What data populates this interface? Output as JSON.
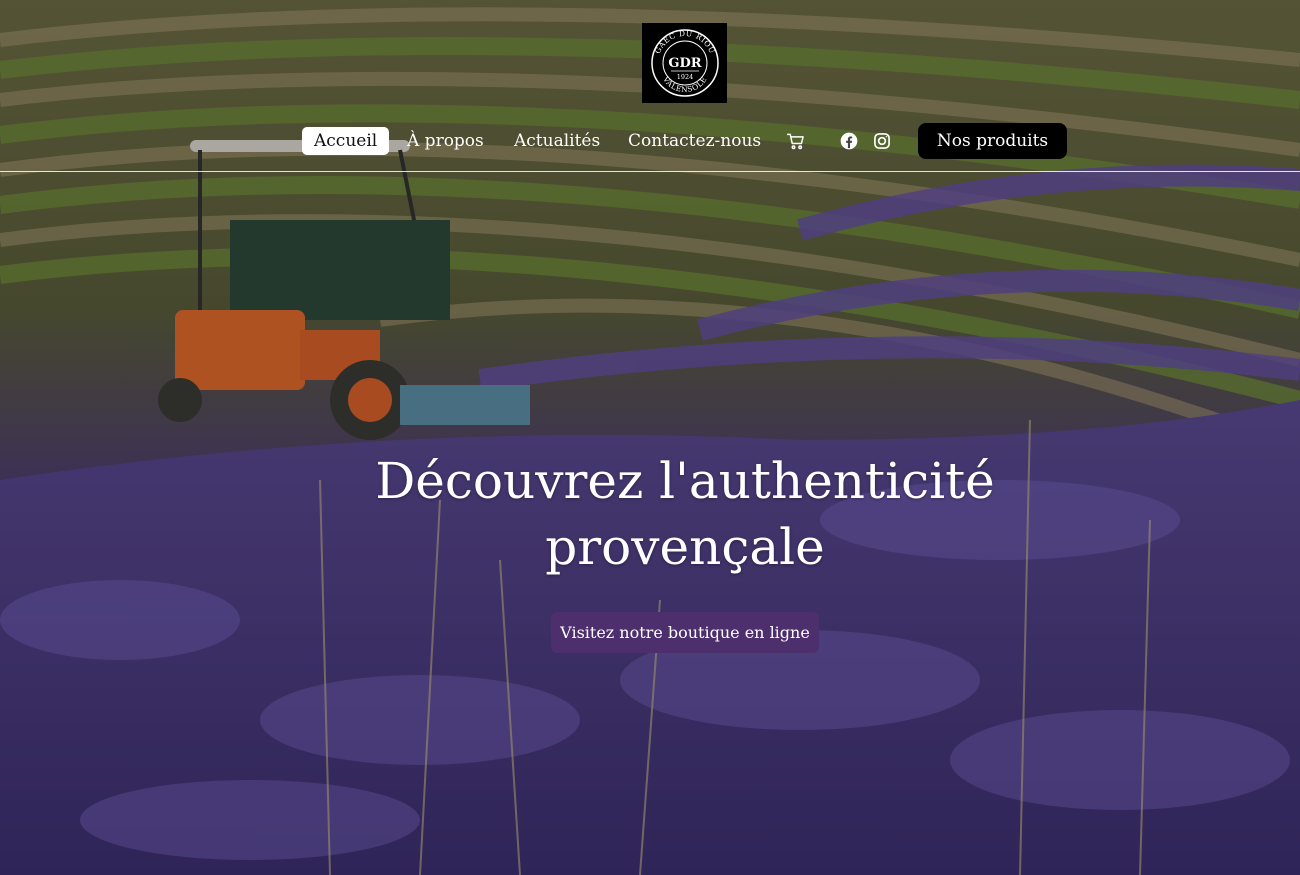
{
  "logo": {
    "name": "logo-emblem",
    "ring_text_top": "GAEC DU RIOU",
    "ring_text_bottom": "VALENSOLE",
    "monogram": "GDR",
    "year": "1924"
  },
  "nav": {
    "items": [
      {
        "label": "Accueil",
        "active": true
      },
      {
        "label": "À propos",
        "active": false
      },
      {
        "label": "Actualités",
        "active": false
      },
      {
        "label": "Contactez-nous",
        "active": false
      }
    ],
    "cart_icon": "cart-icon",
    "social_icons": [
      "facebook-icon",
      "instagram-icon"
    ],
    "products_button": "Nos produits"
  },
  "hero": {
    "headline_line1": "Découvrez l'authenticité",
    "headline_line2": "provençale",
    "cta_label": "Visitez notre boutique en ligne",
    "background": "photo-lavender-field-with-tractor"
  },
  "colors": {
    "cta_background": "#4e2f6e",
    "products_button_background": "#000000",
    "active_nav_background": "#ffffff",
    "text_light": "#ffffff"
  }
}
